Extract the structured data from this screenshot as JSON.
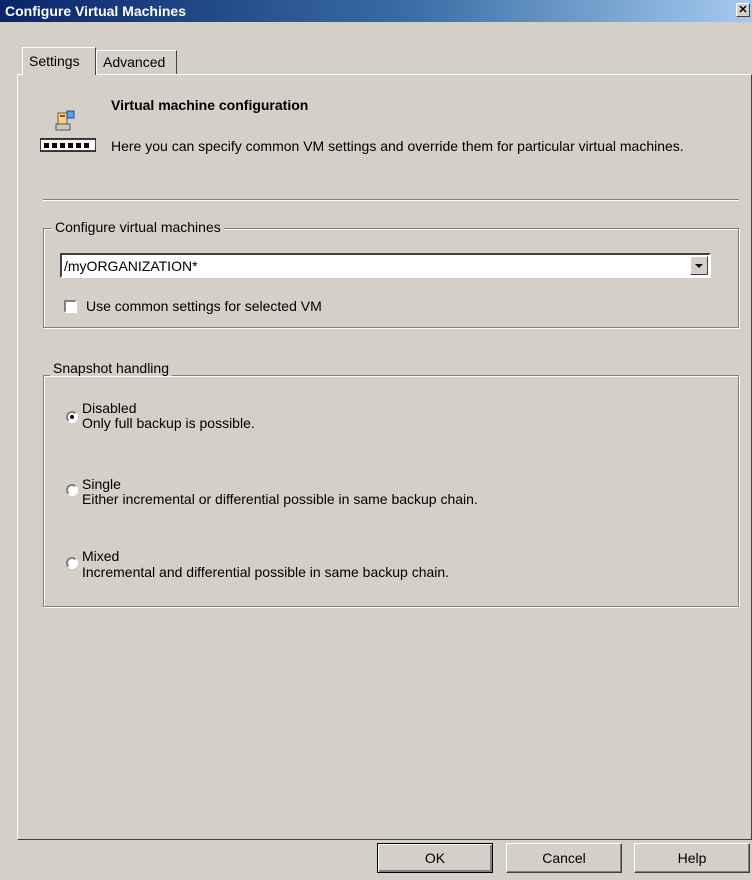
{
  "window": {
    "title": "Configure Virtual Machines",
    "close_label": "✕"
  },
  "tabs": [
    {
      "label": "Settings",
      "active": true
    },
    {
      "label": "Advanced",
      "active": false
    }
  ],
  "header": {
    "icon": "vm-config-icon",
    "title": "Virtual machine configuration",
    "description": "Here you can specify common VM settings and override them for particular virtual machines."
  },
  "configure_group": {
    "legend": "Configure virtual machines",
    "combo_value": "/myORGANIZATION*",
    "checkbox_label": "Use common settings for selected VM",
    "checkbox_checked": false
  },
  "snapshot_group": {
    "legend": "Snapshot handling",
    "options": [
      {
        "title": "Disabled",
        "description": "Only full backup is possible.",
        "selected": true
      },
      {
        "title": "Single",
        "description": "Either incremental or differential possible in same backup chain.",
        "selected": false
      },
      {
        "title": "Mixed",
        "description": "Incremental and differential possible in same backup chain.",
        "selected": false
      }
    ]
  },
  "buttons": {
    "ok": "OK",
    "cancel": "Cancel",
    "help": "Help"
  }
}
